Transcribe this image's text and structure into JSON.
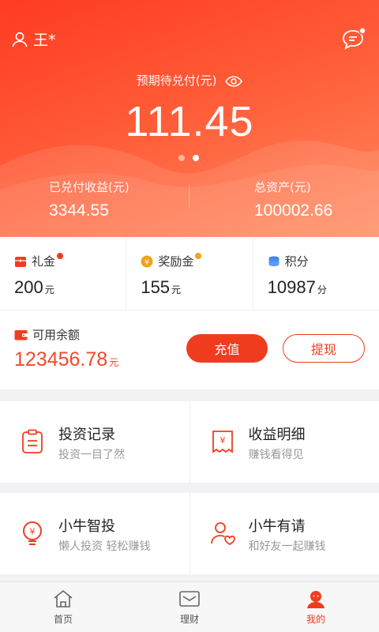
{
  "header": {
    "username": "王*",
    "pending_label": "预期待兑付(元)",
    "pending_value": "111.45",
    "paid_label": "已兑付收益(元)",
    "paid_value": "3344.55",
    "assets_label": "总资产(元)",
    "assets_value": "100002.66"
  },
  "perks": [
    {
      "label": "礼金",
      "value": "200",
      "unit": "元",
      "icon": "gift-icon"
    },
    {
      "label": "奖励金",
      "value": "155",
      "unit": "元",
      "icon": "yen-coin-icon"
    },
    {
      "label": "积分",
      "value": "10987",
      "unit": "分",
      "icon": "coins-stack-icon"
    }
  ],
  "balance": {
    "label": "可用余额",
    "value": "123456.78",
    "unit": "元",
    "recharge_label": "充值",
    "withdraw_label": "提现"
  },
  "menu": [
    {
      "title": "投资记录",
      "subtitle": "投资一目了然",
      "icon": "clipboard-icon"
    },
    {
      "title": "收益明细",
      "subtitle": "赚钱看得见",
      "icon": "yen-receipt-icon"
    },
    {
      "title": "小牛智投",
      "subtitle": "懒人投资 轻松赚钱",
      "icon": "yen-bulb-icon"
    },
    {
      "title": "小牛有请",
      "subtitle": "和好友一起赚钱",
      "icon": "invite-friend-icon"
    }
  ],
  "tabs": [
    {
      "label": "首页",
      "icon": "home-icon"
    },
    {
      "label": "理财",
      "icon": "finance-icon"
    },
    {
      "label": "我的",
      "icon": "profile-icon"
    }
  ],
  "colors": {
    "accent": "#f03c1e",
    "header_start": "#ff3b22",
    "header_end": "#ff8a5e"
  }
}
